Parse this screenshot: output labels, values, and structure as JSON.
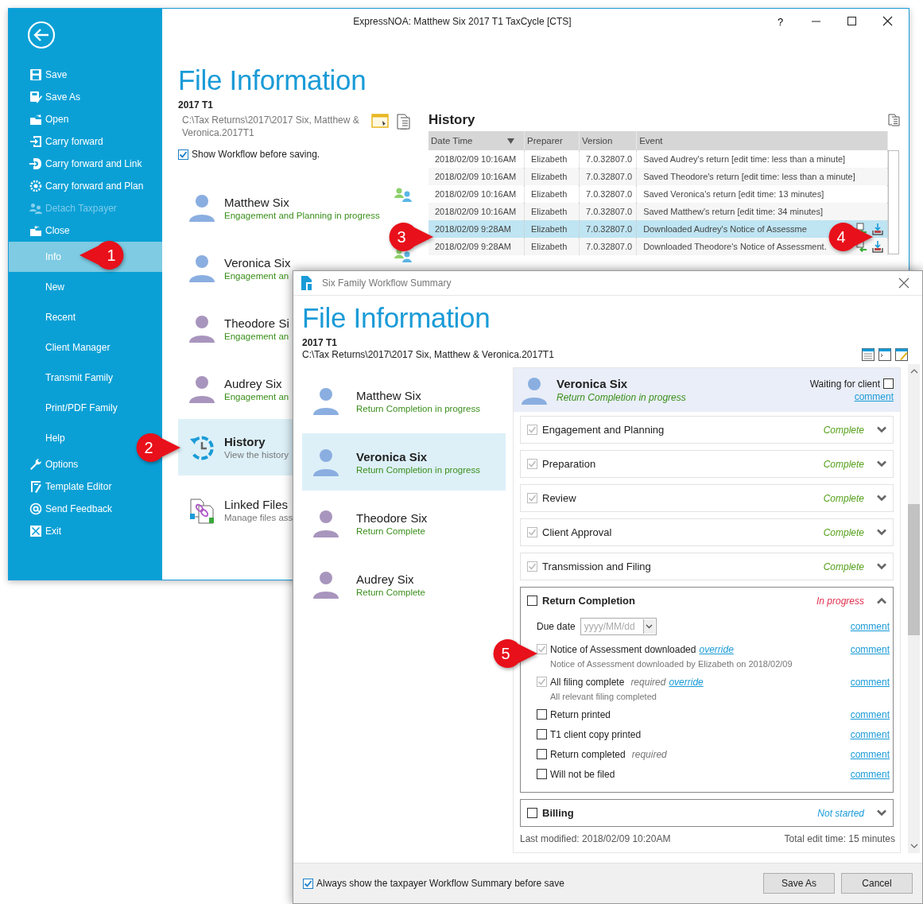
{
  "back_window": {
    "title": "ExpressNOA: Matthew Six 2017 T1 TaxCycle [CTS]",
    "help": "?",
    "sidebar": [
      {
        "label": "Save",
        "kind": "save",
        "disabled": false,
        "selected": false
      },
      {
        "label": "Save As",
        "kind": "save-as",
        "disabled": false,
        "selected": false
      },
      {
        "label": "Open",
        "kind": "open",
        "disabled": false,
        "selected": false
      },
      {
        "label": "Carry forward",
        "kind": "carry",
        "disabled": false,
        "selected": false
      },
      {
        "label": "Carry forward and Link",
        "kind": "link",
        "disabled": false,
        "selected": false
      },
      {
        "label": "Carry forward and Plan",
        "kind": "plan",
        "disabled": false,
        "selected": false
      },
      {
        "label": "Detach Taxpayer",
        "kind": "detach",
        "disabled": true,
        "selected": false
      },
      {
        "label": "Close",
        "kind": "close",
        "disabled": false,
        "selected": false
      },
      {
        "label": "Info",
        "kind": "page",
        "disabled": false,
        "selected": true
      },
      {
        "label": "New",
        "kind": "page",
        "disabled": false,
        "selected": false
      },
      {
        "label": "Recent",
        "kind": "page",
        "disabled": false,
        "selected": false
      },
      {
        "label": "Client Manager",
        "kind": "page",
        "disabled": false,
        "selected": false
      },
      {
        "label": "Transmit Family",
        "kind": "page",
        "disabled": false,
        "selected": false
      },
      {
        "label": "Print/PDF Family",
        "kind": "page",
        "disabled": false,
        "selected": false
      },
      {
        "label": "Help",
        "kind": "page",
        "disabled": false,
        "selected": false
      },
      {
        "label": "Options",
        "kind": "options",
        "disabled": false,
        "selected": false
      },
      {
        "label": "Template Editor",
        "kind": "template",
        "disabled": false,
        "selected": false
      },
      {
        "label": "Send Feedback",
        "kind": "feedback",
        "disabled": false,
        "selected": false
      },
      {
        "label": "Exit",
        "kind": "exit",
        "disabled": false,
        "selected": false
      }
    ],
    "heading": "File Information",
    "year": "2017 T1",
    "path": "C:\\Tax Returns\\2017\\2017 Six, Matthew & Veronica.2017T1",
    "show_workflow": {
      "label": "Show Workflow before saving.",
      "checked": true
    },
    "family": [
      {
        "name": "Matthew Six",
        "status": "Engagement and Planning in progress",
        "color": "#8aaee0",
        "workflow_icon": true
      },
      {
        "name": "Veronica Six",
        "status": "Engagement an",
        "color": "#8aaee0",
        "workflow_icon": true
      },
      {
        "name": "Theodore Si",
        "status": "Engagement an",
        "color": "#a895bd"
      },
      {
        "name": "Audrey Six",
        "status": "Engagement an",
        "color": "#a895bd"
      }
    ],
    "sections": [
      {
        "title": "History",
        "description": "View the history",
        "kind": "history",
        "selected": true
      },
      {
        "title": "Linked Files",
        "description": "Manage files ass",
        "kind": "links",
        "selected": false
      }
    ],
    "history": {
      "title": "History",
      "columns": [
        "Date Time",
        "Preparer",
        "Version",
        "Event"
      ],
      "rows": [
        {
          "cells": [
            "2018/02/09 10:16AM",
            "Elizabeth",
            "7.0.32807.0",
            "Saved Audrey's return [edit time: less than a minute]"
          ],
          "kind": "saved",
          "selected": false
        },
        {
          "cells": [
            "2018/02/09 10:16AM",
            "Elizabeth",
            "7.0.32807.0",
            "Saved Theodore's return [edit time: less than a minute]"
          ],
          "kind": "saved",
          "selected": false
        },
        {
          "cells": [
            "2018/02/09 10:16AM",
            "Elizabeth",
            "7.0.32807.0",
            "Saved Veronica's return [edit time: 13 minutes]"
          ],
          "kind": "saved",
          "selected": false
        },
        {
          "cells": [
            "2018/02/09 10:16AM",
            "Elizabeth",
            "7.0.32807.0",
            "Saved Matthew's return [edit time: 34 minutes]"
          ],
          "kind": "saved",
          "selected": false
        },
        {
          "cells": [
            "2018/02/09 9:28AM",
            "Elizabeth",
            "7.0.32807.0",
            "Downloaded Audrey's Notice of Assessme"
          ],
          "kind": "download",
          "selected": true
        },
        {
          "cells": [
            "2018/02/09 9:28AM",
            "Elizabeth",
            "7.0.32807.0",
            "Downloaded Theodore's Notice of Assessment."
          ],
          "kind": "download",
          "selected": false
        }
      ]
    }
  },
  "workflow_dialog": {
    "title": "Six Family Workflow Summary",
    "heading": "File Information",
    "year": "2017 T1",
    "path": "C:\\Tax Returns\\2017\\2017 Six, Matthew & Veronica.2017T1",
    "family": [
      {
        "name": "Matthew Six",
        "status": "Return Completion in progress",
        "color": "#8aaee0",
        "selected": false
      },
      {
        "name": "Veronica Six",
        "status": "Return Completion in progress",
        "color": "#8aaee0",
        "selected": true
      },
      {
        "name": "Theodore Six",
        "status": "Return Complete",
        "color": "#a895bd",
        "selected": false
      },
      {
        "name": "Audrey Six",
        "status": "Return Complete",
        "color": "#a895bd",
        "selected": false
      }
    ],
    "detail": {
      "name": "Veronica Six",
      "status": "Return Completion in progress",
      "color": "#8aaee0",
      "waiting_label": "Waiting for client",
      "waiting": false,
      "comment": "comment",
      "stages": [
        {
          "name": "Engagement and Planning",
          "status": "Complete",
          "kind": "complete",
          "checked": true,
          "expanded": false
        },
        {
          "name": "Preparation",
          "status": "Complete",
          "kind": "complete",
          "checked": true,
          "expanded": false
        },
        {
          "name": "Review",
          "status": "Complete",
          "kind": "complete",
          "checked": true,
          "expanded": false
        },
        {
          "name": "Client Approval",
          "status": "Complete",
          "kind": "complete",
          "checked": true,
          "expanded": false
        },
        {
          "name": "Transmission and Filing",
          "status": "Complete",
          "kind": "complete",
          "checked": true,
          "expanded": false
        },
        {
          "name": "Return Completion",
          "status": "In progress",
          "kind": "in-progress",
          "checked": false,
          "expanded": true,
          "due_date": {
            "label": "Due date",
            "placeholder": "yyyy/MM/dd",
            "comment": "comment"
          },
          "tasks": [
            {
              "label": "Notice of Assessment downloaded",
              "checked": true,
              "override": "override",
              "detail": "Notice of Assessment downloaded by Elizabeth on 2018/02/09",
              "comment": "comment"
            },
            {
              "label": "All filing complete",
              "checked": true,
              "required": "required",
              "override": "override",
              "detail": "All relevant filing completed",
              "comment": "comment"
            },
            {
              "label": "Return printed",
              "checked": false,
              "comment": "comment"
            },
            {
              "label": "T1 client copy printed",
              "checked": false,
              "comment": "comment"
            },
            {
              "label": "Return completed",
              "checked": false,
              "required": "required",
              "comment": "comment"
            },
            {
              "label": "Will not be filed",
              "checked": false,
              "comment": "comment"
            }
          ]
        },
        {
          "name": "Billing",
          "status": "Not started",
          "kind": "not-started",
          "checked": false,
          "expanded": false
        }
      ],
      "last_modified": "Last modified: 2018/02/09 10:20AM",
      "total_edit_time": "Total edit time: 15 minutes"
    },
    "always_show": {
      "label": "Always show the taxpayer Workflow Summary before save",
      "checked": true
    },
    "buttons": [
      "Save As",
      "Cancel"
    ]
  },
  "callouts": [
    {
      "number": "1"
    },
    {
      "number": "2"
    },
    {
      "number": "3"
    },
    {
      "number": "4"
    },
    {
      "number": "5"
    }
  ]
}
